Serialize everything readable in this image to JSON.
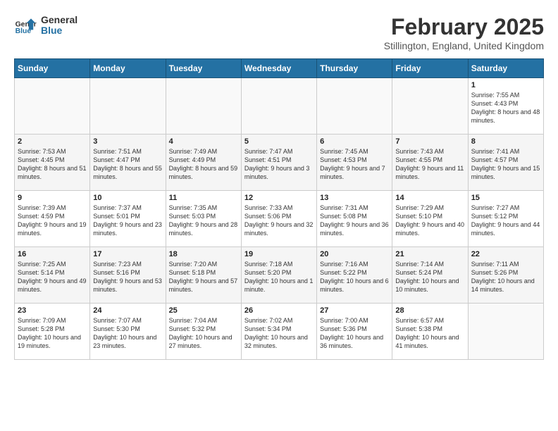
{
  "logo": {
    "text_general": "General",
    "text_blue": "Blue"
  },
  "title": "February 2025",
  "subtitle": "Stillington, England, United Kingdom",
  "headers": [
    "Sunday",
    "Monday",
    "Tuesday",
    "Wednesday",
    "Thursday",
    "Friday",
    "Saturday"
  ],
  "weeks": [
    [
      {
        "day": "",
        "info": ""
      },
      {
        "day": "",
        "info": ""
      },
      {
        "day": "",
        "info": ""
      },
      {
        "day": "",
        "info": ""
      },
      {
        "day": "",
        "info": ""
      },
      {
        "day": "",
        "info": ""
      },
      {
        "day": "1",
        "info": "Sunrise: 7:55 AM\nSunset: 4:43 PM\nDaylight: 8 hours and 48 minutes."
      }
    ],
    [
      {
        "day": "2",
        "info": "Sunrise: 7:53 AM\nSunset: 4:45 PM\nDaylight: 8 hours and 51 minutes."
      },
      {
        "day": "3",
        "info": "Sunrise: 7:51 AM\nSunset: 4:47 PM\nDaylight: 8 hours and 55 minutes."
      },
      {
        "day": "4",
        "info": "Sunrise: 7:49 AM\nSunset: 4:49 PM\nDaylight: 8 hours and 59 minutes."
      },
      {
        "day": "5",
        "info": "Sunrise: 7:47 AM\nSunset: 4:51 PM\nDaylight: 9 hours and 3 minutes."
      },
      {
        "day": "6",
        "info": "Sunrise: 7:45 AM\nSunset: 4:53 PM\nDaylight: 9 hours and 7 minutes."
      },
      {
        "day": "7",
        "info": "Sunrise: 7:43 AM\nSunset: 4:55 PM\nDaylight: 9 hours and 11 minutes."
      },
      {
        "day": "8",
        "info": "Sunrise: 7:41 AM\nSunset: 4:57 PM\nDaylight: 9 hours and 15 minutes."
      }
    ],
    [
      {
        "day": "9",
        "info": "Sunrise: 7:39 AM\nSunset: 4:59 PM\nDaylight: 9 hours and 19 minutes."
      },
      {
        "day": "10",
        "info": "Sunrise: 7:37 AM\nSunset: 5:01 PM\nDaylight: 9 hours and 23 minutes."
      },
      {
        "day": "11",
        "info": "Sunrise: 7:35 AM\nSunset: 5:03 PM\nDaylight: 9 hours and 28 minutes."
      },
      {
        "day": "12",
        "info": "Sunrise: 7:33 AM\nSunset: 5:06 PM\nDaylight: 9 hours and 32 minutes."
      },
      {
        "day": "13",
        "info": "Sunrise: 7:31 AM\nSunset: 5:08 PM\nDaylight: 9 hours and 36 minutes."
      },
      {
        "day": "14",
        "info": "Sunrise: 7:29 AM\nSunset: 5:10 PM\nDaylight: 9 hours and 40 minutes."
      },
      {
        "day": "15",
        "info": "Sunrise: 7:27 AM\nSunset: 5:12 PM\nDaylight: 9 hours and 44 minutes."
      }
    ],
    [
      {
        "day": "16",
        "info": "Sunrise: 7:25 AM\nSunset: 5:14 PM\nDaylight: 9 hours and 49 minutes."
      },
      {
        "day": "17",
        "info": "Sunrise: 7:23 AM\nSunset: 5:16 PM\nDaylight: 9 hours and 53 minutes."
      },
      {
        "day": "18",
        "info": "Sunrise: 7:20 AM\nSunset: 5:18 PM\nDaylight: 9 hours and 57 minutes."
      },
      {
        "day": "19",
        "info": "Sunrise: 7:18 AM\nSunset: 5:20 PM\nDaylight: 10 hours and 1 minute."
      },
      {
        "day": "20",
        "info": "Sunrise: 7:16 AM\nSunset: 5:22 PM\nDaylight: 10 hours and 6 minutes."
      },
      {
        "day": "21",
        "info": "Sunrise: 7:14 AM\nSunset: 5:24 PM\nDaylight: 10 hours and 10 minutes."
      },
      {
        "day": "22",
        "info": "Sunrise: 7:11 AM\nSunset: 5:26 PM\nDaylight: 10 hours and 14 minutes."
      }
    ],
    [
      {
        "day": "23",
        "info": "Sunrise: 7:09 AM\nSunset: 5:28 PM\nDaylight: 10 hours and 19 minutes."
      },
      {
        "day": "24",
        "info": "Sunrise: 7:07 AM\nSunset: 5:30 PM\nDaylight: 10 hours and 23 minutes."
      },
      {
        "day": "25",
        "info": "Sunrise: 7:04 AM\nSunset: 5:32 PM\nDaylight: 10 hours and 27 minutes."
      },
      {
        "day": "26",
        "info": "Sunrise: 7:02 AM\nSunset: 5:34 PM\nDaylight: 10 hours and 32 minutes."
      },
      {
        "day": "27",
        "info": "Sunrise: 7:00 AM\nSunset: 5:36 PM\nDaylight: 10 hours and 36 minutes."
      },
      {
        "day": "28",
        "info": "Sunrise: 6:57 AM\nSunset: 5:38 PM\nDaylight: 10 hours and 41 minutes."
      },
      {
        "day": "",
        "info": ""
      }
    ]
  ]
}
